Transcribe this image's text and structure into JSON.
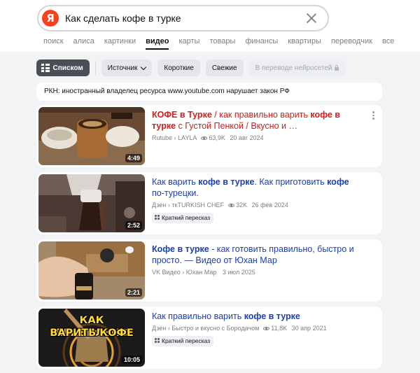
{
  "search": {
    "logo": "Я",
    "query": "Как сделать кофе в турке"
  },
  "nav": [
    "поиск",
    "алиса",
    "картинки",
    "видео",
    "карты",
    "товары",
    "финансы",
    "квартиры",
    "переводчик",
    "все"
  ],
  "nav_active": "видео",
  "filters": {
    "list_view": "Списком",
    "source": "Источник",
    "short": "Короткие",
    "fresh": "Свежие",
    "neuro_translation": "В переводе нейросетей"
  },
  "notice": "РКН: иностранный владелец ресурса www.youtube.com нарушает закон РФ",
  "results": [
    {
      "title_parts": [
        {
          "text": "КОФЕ в Турке",
          "bold": true
        },
        {
          "text": " / как правильно варить ",
          "bold": false
        },
        {
          "text": "кофе в турке",
          "bold": true
        },
        {
          "text": " с Густой Пенкой / Вкусно и …",
          "bold": false
        }
      ],
      "source": "Rutube › LAYLA",
      "views": "63,9K",
      "date": "20 авг 2024",
      "duration": "4:49",
      "retell": ""
    },
    {
      "title_parts": [
        {
          "text": "Как варить ",
          "bold": false
        },
        {
          "text": "кофе в турке",
          "bold": true
        },
        {
          "text": ". Как приготовить ",
          "bold": false
        },
        {
          "text": "кофе",
          "bold": true
        },
        {
          "text": " по-турецки.",
          "bold": false
        }
      ],
      "source": "Дзен › ткTURKISH CHEF",
      "views": "32K",
      "date": "26 фев 2024",
      "duration": "2:52",
      "retell": "Краткий пересказ"
    },
    {
      "title_parts": [
        {
          "text": "Кофе в турке",
          "bold": true
        },
        {
          "text": " - как готовить правильно, быстро и просто. — Видео от Юхан Мар",
          "bold": false
        }
      ],
      "source": "VK Видео › Юхан Мар",
      "views": "",
      "date": "3 июл 2025",
      "duration": "2:21",
      "retell": ""
    },
    {
      "title_parts": [
        {
          "text": "Как правильно варить ",
          "bold": false
        },
        {
          "text": "кофе в турке",
          "bold": true
        }
      ],
      "source": "Дзен › Быстро и вкусно с Бородачом",
      "views": "11,8K",
      "date": "30 апр 2021",
      "duration": "10:05",
      "retell": "Краткий пересказ",
      "thumb_text": [
        "КАК ПРАВИЛЬНО",
        "ВАРИТЬ КОФЕ"
      ]
    }
  ],
  "colors": {
    "logo": "#fc3f1d",
    "link": "#1a3dbb",
    "first_link": "#d31c1c",
    "background": "#f2f3f5"
  }
}
